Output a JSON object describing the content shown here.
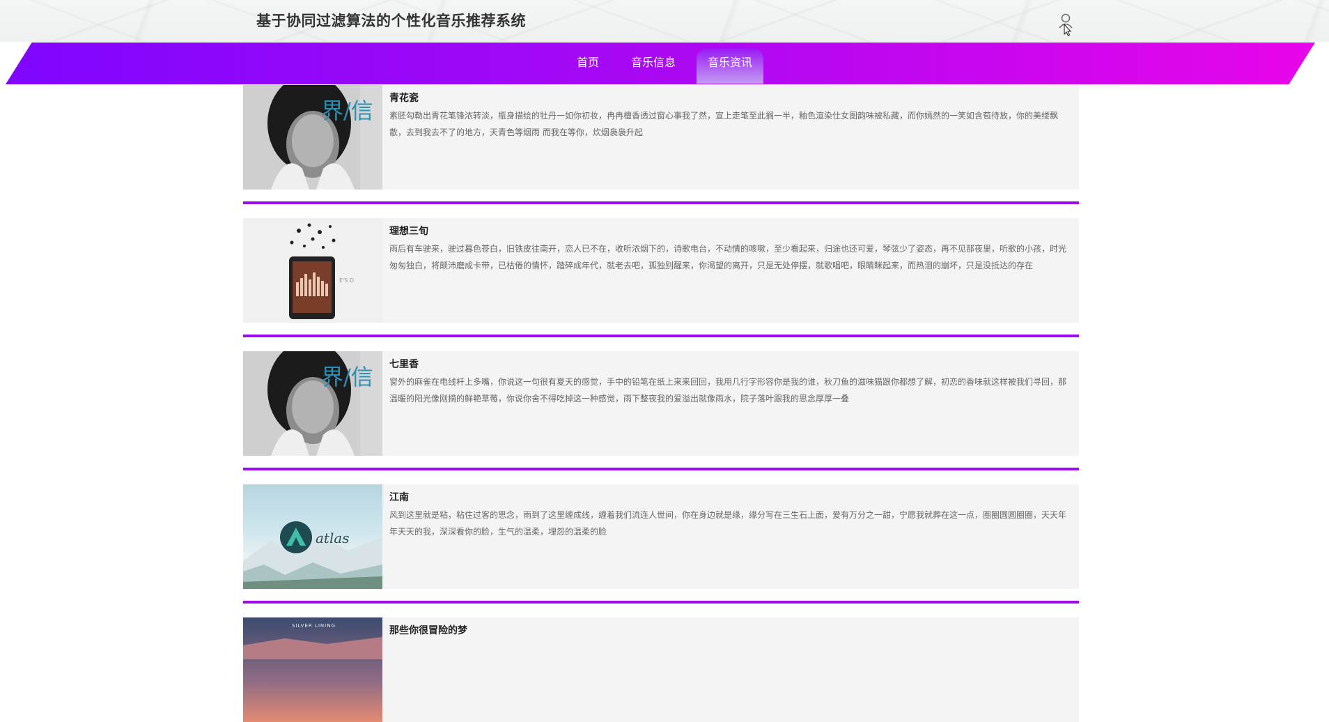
{
  "header": {
    "site_title": "基于协同过滤算法的个性化音乐推荐系统",
    "user_icon": "user-icon"
  },
  "nav": {
    "items": [
      {
        "label": "首页",
        "active": false
      },
      {
        "label": "音乐信息",
        "active": false
      },
      {
        "label": "音乐资讯",
        "active": true
      }
    ]
  },
  "news": [
    {
      "title": "青花瓷",
      "desc": "素胚勾勒出青花笔锋浓转淡，瓶身描绘的牡丹一如你初妆，冉冉檀香透过窗心事我了然，宣上走笔至此搁一半，釉色渲染仕女图韵味被私藏，而你嫣然的一笑如含苞待放，你的美缕飘散，去到我去不了的地方，天青色等烟雨 而我在等你，炊烟袅袅升起",
      "image": "album-cover-portrait"
    },
    {
      "title": "理想三旬",
      "desc": "雨后有车驶来，驶过暮色苍白，旧铁皮往南开，恋人已不在，收听浓烟下的，诗歌电台，不动情的咳嗽，至少看起来，归途也还可爱，琴弦少了姿态，再不见那夜里，听歌的小孩，时光匆匆独白，将颠沛磨成卡带，已枯倦的情怀，踏碎成年代，就老去吧，孤独别醒来，你渴望的离开，只是无处停摆，就歌唱吧，眼睛眯起来，而热泪的崩坏，只是没抵达的存在",
      "image": "album-cover-tablet"
    },
    {
      "title": "七里香",
      "desc": "窗外的麻雀在电线杆上多嘴，你说这一句很有夏天的感觉，手中的铅笔在纸上来来回回，我用几行字形容你是我的谁，秋刀鱼的滋味猫跟你都想了解，初恋的香味就这样被我们寻回，那温暖的阳光像刚摘的鲜艳草莓，你说你舍不得吃掉这一种感觉，雨下整夜我的爱溢出就像雨水，院子落叶跟我的思念厚厚一叠",
      "image": "album-cover-portrait"
    },
    {
      "title": "江南",
      "desc": "风到这里就是粘，粘住过客的思念，雨到了这里缠成线，缠着我们流连人世间，你在身边就是缘，缘分写在三生石上面，爱有万分之一甜，宁愿我就葬在这一点，圈圈圆圆圈圈，天天年年天天的我，深深看你的脸，生气的温柔，埋怨的温柔的脸",
      "image": "album-cover-atlas"
    },
    {
      "title": "那些你很冒险的梦",
      "desc": "",
      "image": "album-cover-silver-lining",
      "image_text": "SILVER LINING"
    }
  ],
  "thumb_text": {
    "portrait_text": "界/信",
    "tablet_text": "E'S D",
    "atlas_text": "atlas"
  },
  "colors": {
    "nav_start": "#7f06ff",
    "nav_end": "#e805ea",
    "divider": "#9b0df0"
  }
}
